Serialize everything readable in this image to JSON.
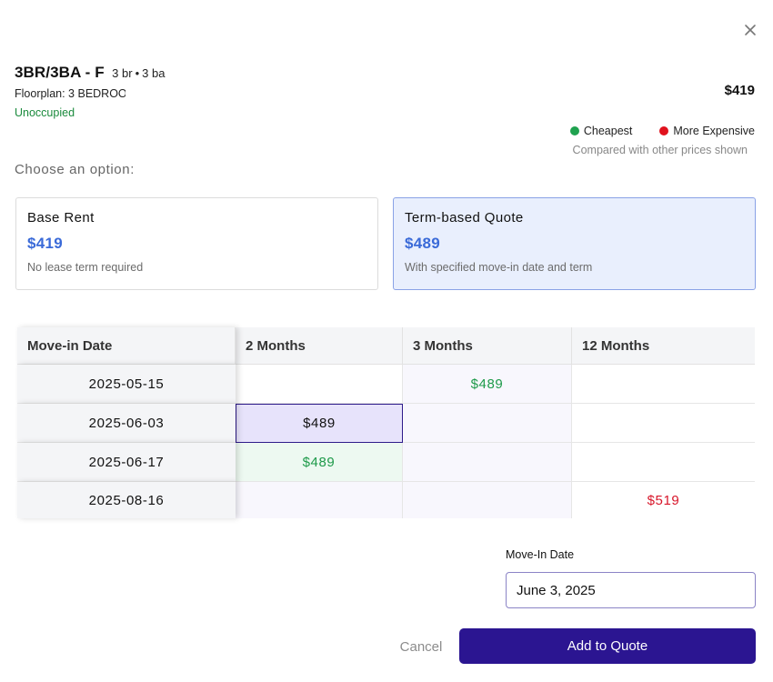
{
  "dialog": {
    "close_icon": "close-icon"
  },
  "unit": {
    "title": "3BR/3BA - F",
    "beds": "3 br",
    "separator": "•",
    "baths": "3 ba",
    "floorplan": "Floorplan: 3 BEDROOM",
    "occupancy": "Unoccupied",
    "price": "$419"
  },
  "legend": {
    "cheapest_label": "Cheapest",
    "cheapest_color": "#1fa24f",
    "expensive_label": "More Expensive",
    "expensive_color": "#e0121d",
    "note": "Compared with other prices shown"
  },
  "options": {
    "prompt": "Choose an option:",
    "base_rent": {
      "title": "Base Rent",
      "price": "$419",
      "description": "No lease term required"
    },
    "term_quote": {
      "title": "Term-based Quote",
      "price": "$489",
      "description": "With specified move-in date and term",
      "selected": true
    }
  },
  "grid": {
    "headers": [
      "Move-in Date",
      "2 Months",
      "3 Months",
      "12 Months"
    ],
    "rows": [
      {
        "date": "2025-05-15",
        "m2": "",
        "m3": "$489",
        "m12": ""
      },
      {
        "date": "2025-06-03",
        "m2": "$489",
        "m3": "",
        "m12": ""
      },
      {
        "date": "2025-06-17",
        "m2": "$489",
        "m3": "",
        "m12": ""
      },
      {
        "date": "2025-08-16",
        "m2": "",
        "m3": "",
        "m12": "$519"
      }
    ]
  },
  "movein": {
    "label": "Move-In Date",
    "value": "June 3, 2025"
  },
  "actions": {
    "cancel_label": "Cancel",
    "add_label": "Add to Quote"
  }
}
